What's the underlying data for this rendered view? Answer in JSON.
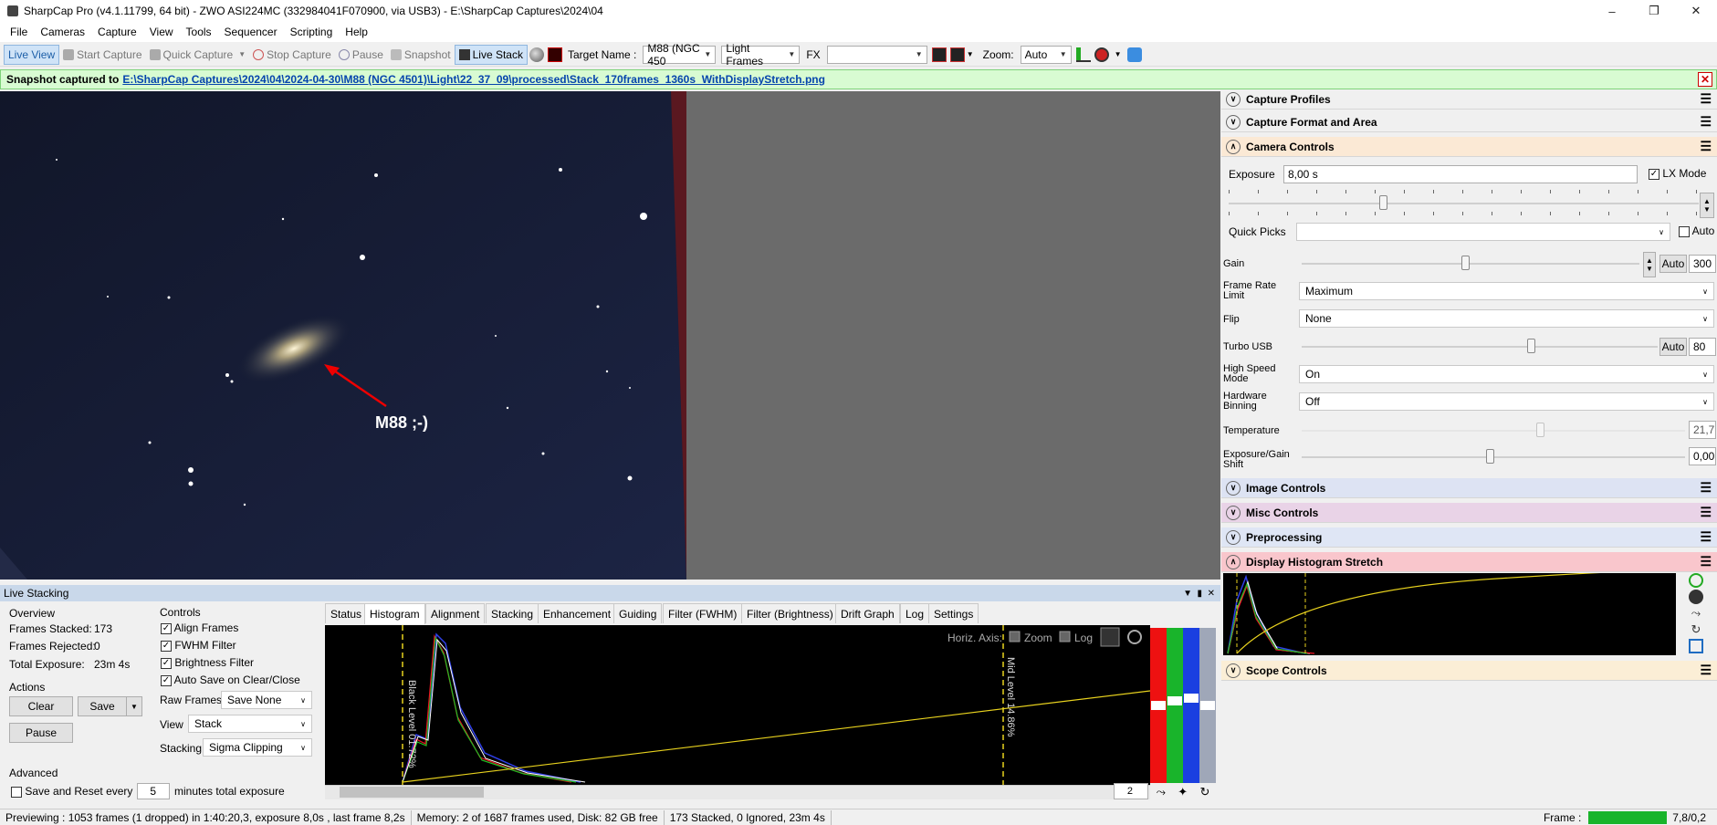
{
  "window": {
    "title": "SharpCap Pro (v4.1.11799, 64 bit) - ZWO ASI224MC (332984041F070900, via USB3) - E:\\SharpCap Captures\\2024\\04"
  },
  "menu": [
    "File",
    "Cameras",
    "Capture",
    "View",
    "Tools",
    "Sequencer",
    "Scripting",
    "Help"
  ],
  "toolbar": {
    "live_view": "Live View",
    "start_capture": "Start Capture",
    "quick_capture": "Quick Capture",
    "stop_capture": "Stop Capture",
    "pause": "Pause",
    "snapshot": "Snapshot",
    "live_stack": "Live Stack",
    "target_label": "Target Name :",
    "target_value": "M88 (NGC 450",
    "frame_type": "Light Frames",
    "fx_label": "FX",
    "zoom_label": "Zoom:",
    "zoom_value": "Auto"
  },
  "notification": {
    "prefix": "Snapshot captured to",
    "path": "E:\\SharpCap Captures\\2024\\04\\2024-04-30\\M88 (NGC 4501)\\Light\\22_37_09\\processed\\Stack_170frames_1360s_WithDisplayStretch.png"
  },
  "image": {
    "annotation": "M88 ;-)"
  },
  "right_panel": {
    "sections": {
      "capture_profiles": "Capture Profiles",
      "capture_format": "Capture Format and Area",
      "camera_controls": "Camera Controls",
      "image_controls": "Image Controls",
      "misc_controls": "Misc Controls",
      "preprocessing": "Preprocessing",
      "display_stretch": "Display Histogram Stretch",
      "scope_controls": "Scope Controls"
    },
    "colors": {
      "camera_controls": "#fbe9d5",
      "image_controls": "#dde3f3",
      "misc_controls": "#e9d3e7",
      "preprocessing": "#dfe6f5",
      "display_stretch": "#f9c6cc",
      "scope_controls": "#fbeed6"
    },
    "camera": {
      "exposure_label": "Exposure",
      "exposure_value": "8,00 s",
      "lx_mode": "LX Mode",
      "quick_picks_label": "Quick Picks",
      "auto_label": "Auto",
      "gain_label": "Gain",
      "gain_auto": "Auto",
      "gain_value": "300",
      "frame_rate_label": "Frame Rate Limit",
      "frame_rate_value": "Maximum",
      "flip_label": "Flip",
      "flip_value": "None",
      "turbo_label": "Turbo USB",
      "turbo_auto": "Auto",
      "turbo_value": "80",
      "high_speed_label": "High Speed Mode",
      "high_speed_value": "On",
      "hw_binning_label": "Hardware Binning",
      "hw_binning_value": "Off",
      "temperature_label": "Temperature",
      "temperature_value": "21,7",
      "exp_gain_shift_label": "Exposure/Gain Shift",
      "exp_gain_shift_value": "0,00"
    }
  },
  "live_stacking": {
    "title": "Live Stacking",
    "overview": {
      "heading": "Overview",
      "frames_stacked_label": "Frames Stacked:",
      "frames_stacked": "173",
      "frames_rejected_label": "Frames Rejected:",
      "frames_rejected": "0",
      "total_exposure_label": "Total Exposure:",
      "total_exposure": "23m 4s"
    },
    "actions": {
      "heading": "Actions",
      "clear": "Clear",
      "save": "Save",
      "pause": "Pause"
    },
    "advanced": {
      "heading": "Advanced",
      "save_reset": "Save and Reset every",
      "minutes_value": "5",
      "minutes_suffix": "minutes total exposure"
    },
    "controls": {
      "heading": "Controls",
      "align": "Align Frames",
      "fwhm": "FWHM Filter",
      "brightness": "Brightness Filter",
      "autosave": "Auto Save on Clear/Close",
      "raw_frames_label": "Raw Frames",
      "raw_frames_value": "Save None",
      "view_label": "View",
      "view_value": "Stack",
      "stacking_label": "Stacking",
      "stacking_value": "Sigma Clipping"
    },
    "tabs": [
      "Status",
      "Histogram",
      "Alignment",
      "Stacking",
      "Enhancement",
      "Guiding",
      "Filter (FWHM)",
      "Filter (Brightness)",
      "Drift Graph",
      "Log",
      "Settings"
    ],
    "histogram": {
      "horiz_axis": "Horiz. Axis:",
      "zoom": "Zoom",
      "log": "Log",
      "black_level": "Black Level 01.72%",
      "mid_level": "Mid Level 14.86%",
      "spin_value": "2"
    }
  },
  "status": {
    "preview": "Previewing : 1053 frames (1 dropped) in 1:40:20,3, exposure 8,0s , last frame 8,2s",
    "memory": "Memory: 2 of 1687 frames used, Disk: 82 GB free",
    "stack": "173 Stacked, 0 Ignored, 23m 4s",
    "frame_label": "Frame :",
    "frame_value": "7,8/0,2"
  }
}
